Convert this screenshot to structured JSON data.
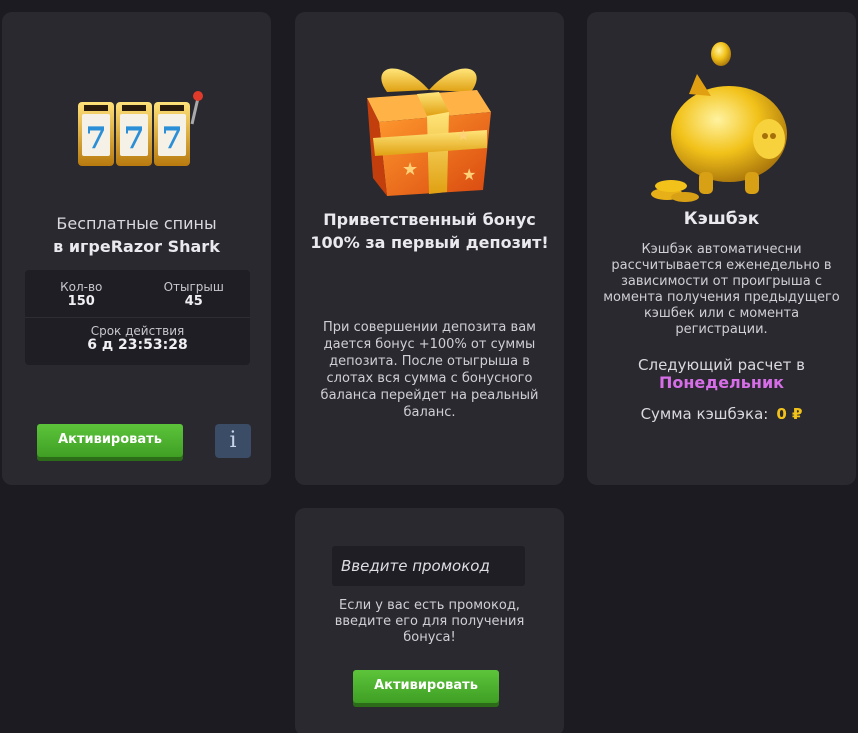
{
  "spins_card": {
    "title_line1": "Бесплатные спины",
    "title_line2": "в игреRazor Shark",
    "count_label": "Кол-во",
    "count_value": "150",
    "wager_label": "Отыгрыш",
    "wager_value": "45",
    "validity_label": "Срок действия",
    "validity_value": "6 д 23:53:28",
    "activate_label": "Активировать",
    "info_label": "i",
    "image_icon": "slot-machine-777-icon"
  },
  "bonus_card": {
    "title": "Приветственный бонус 100% за первый депозит!",
    "description": "При совершении депозита вам дается бонус +100% от суммы депозита. После отыгрыша в слотах вся сумма с бонусного баланса перейдет на реальный баланс.",
    "image_icon": "gift-box-icon"
  },
  "cashback_card": {
    "title": "Кэшбэк",
    "description": "Кэшбэк автоматичесни рассчитывается еженедельно в зависимости от проигрыша с момента получения предыдущего кэшбек или с момента регистрации.",
    "next_label": "Следующий расчет в",
    "next_day": "Понедельник",
    "sum_label": "Сумма кэшбэка:",
    "sum_value": "0 ₽",
    "image_icon": "piggy-bank-icon"
  },
  "promo_card": {
    "input_placeholder": "Введите промокод",
    "description": "Если у вас есть промокод, введите его для получения бонуса!",
    "activate_label": "Активировать"
  },
  "colors": {
    "background": "#1c1b21",
    "card": "#2a2930",
    "button_green": "#4cb22e",
    "accent_purple": "#d76ee8",
    "accent_gold": "#f2c21a"
  }
}
